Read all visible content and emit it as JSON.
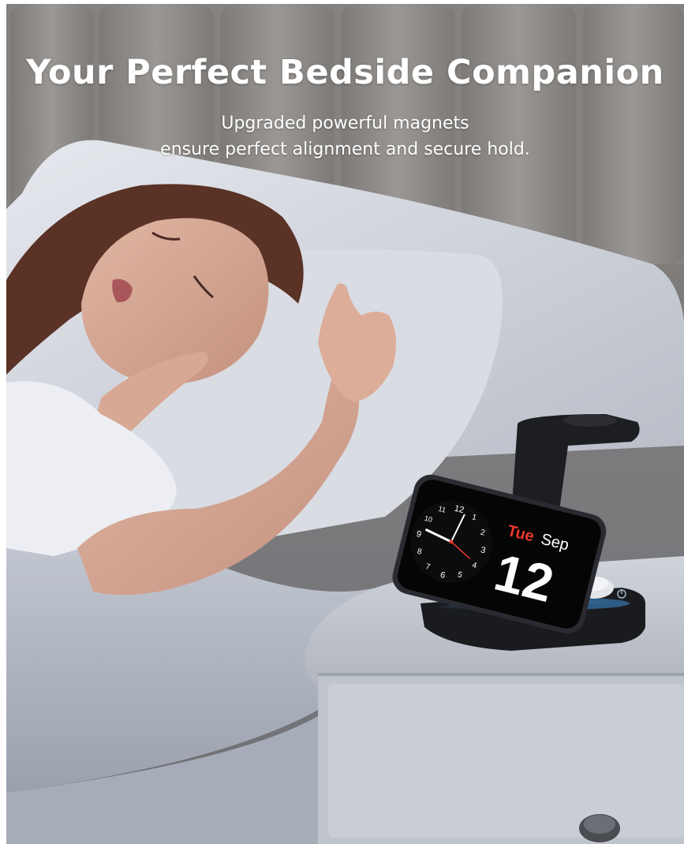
{
  "headline": "Your Perfect Bedside Companion",
  "subheadline": {
    "line1": "Upgraded powerful magnets",
    "line2": "ensure perfect alignment and secure hold."
  },
  "phone_screen": {
    "weekday": "Tue",
    "month": "Sep",
    "day": "12",
    "clock_numerals": [
      "12",
      "1",
      "2",
      "3",
      "4",
      "5",
      "6",
      "7",
      "8",
      "9",
      "10",
      "11"
    ]
  },
  "colors": {
    "headline_text": "#ffffff",
    "weekday_red": "#e8372c",
    "charger_glow": "#3f8fd6"
  },
  "icons": [
    "charger-power-icon"
  ]
}
